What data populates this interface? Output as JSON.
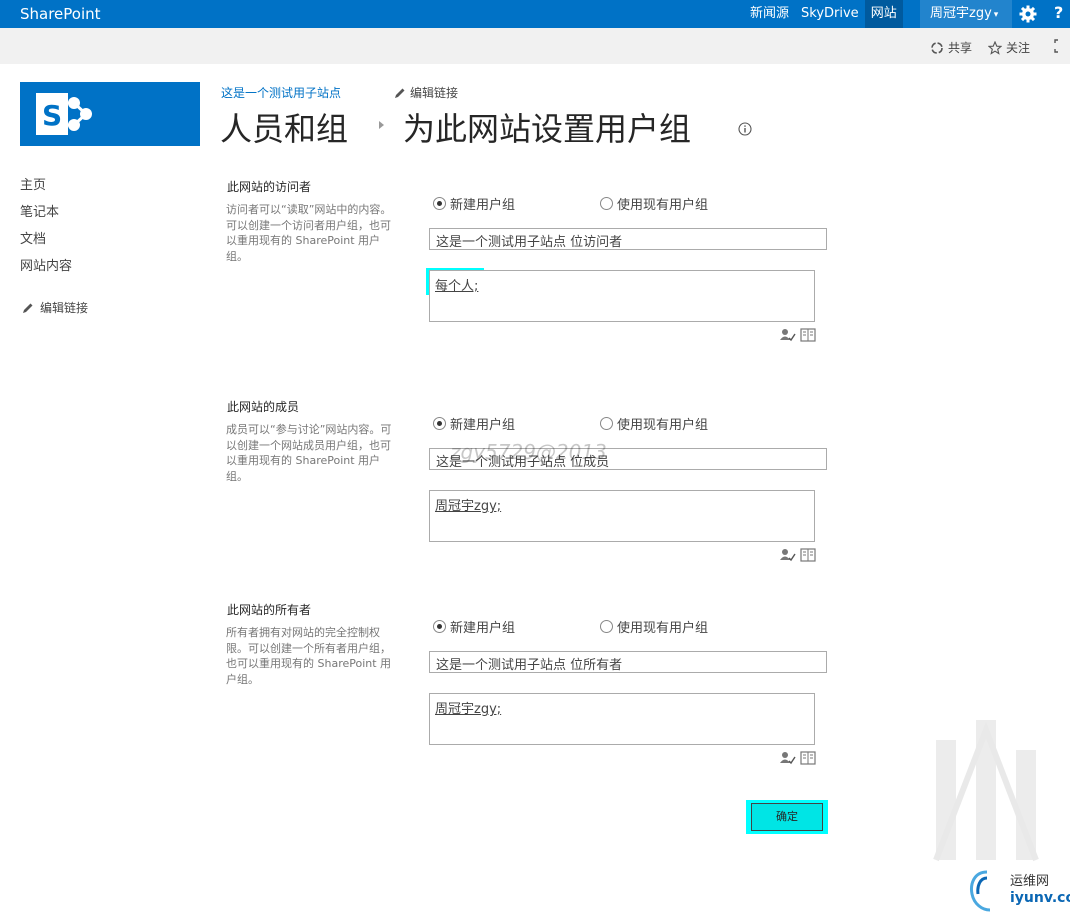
{
  "suitebar": {
    "brand": "SharePoint",
    "nav": [
      "新闻源",
      "SkyDrive",
      "网站"
    ],
    "user": "周冠宇zgy"
  },
  "commands": {
    "share": "共享",
    "follow": "关注"
  },
  "header": {
    "site_link": "这是一个测试用子站点",
    "edit_links": "编辑链接",
    "crumb_parent": "人员和组",
    "crumb_current": "为此网站设置用户组"
  },
  "leftnav": {
    "items": [
      "主页",
      "笔记本",
      "文档",
      "网站内容"
    ],
    "edit_links": "编辑链接"
  },
  "sections": [
    {
      "title": "此网站的访问者",
      "description": "访问者可以“读取”网站中的内容。可以创建一个访问者用户组，也可以重用现有的 SharePoint 用户组。",
      "option_new": "新建用户组",
      "option_existing": "使用现有用户组",
      "group_name": "这是一个测试用子站点 位访问者",
      "people": "每个人;"
    },
    {
      "title": "此网站的成员",
      "description": "成员可以“参与讨论”网站内容。可以创建一个网站成员用户组，也可以重用现有的 SharePoint 用户组。",
      "option_new": "新建用户组",
      "option_existing": "使用现有用户组",
      "group_name": "这是一个测试用子站点 位成员",
      "people": "周冠宇zgy;"
    },
    {
      "title": "此网站的所有者",
      "description": "所有者拥有对网站的完全控制权限。可以创建一个所有者用户组，也可以重用现有的 SharePoint 用户组。",
      "option_new": "新建用户组",
      "option_existing": "使用现有用户组",
      "group_name": "这是一个测试用子站点 位所有者",
      "people": "周冠宇zgy;"
    }
  ],
  "ok_label": "确定",
  "watermark": {
    "text": "zgy5729@2013",
    "brand_cn": "运维网",
    "brand_en": "iyunv.com"
  },
  "colors": {
    "suitebar": "#0072c6",
    "highlight": "#00ffff",
    "link": "#0072c6"
  }
}
